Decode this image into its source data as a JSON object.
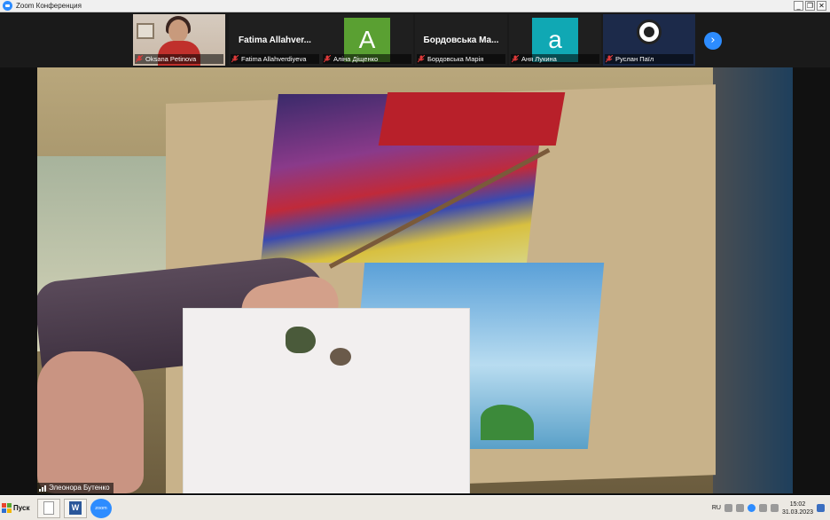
{
  "window": {
    "title": "Zoom Конференция",
    "minimize": "_",
    "restore": "❐",
    "close": "✕"
  },
  "participants": [
    {
      "name": "Oksana Petinova",
      "type": "video",
      "big_name": ""
    },
    {
      "name": "Fatima Allahverdiyeva",
      "type": "name",
      "big_name": "Fatima Allahver..."
    },
    {
      "name": "Аліна Діщенко",
      "type": "avatar",
      "initial": "A",
      "color": "#5aa032"
    },
    {
      "name": "Бордовська Марія",
      "type": "name",
      "big_name": "Бордовська Ма..."
    },
    {
      "name": "Аня Лукина",
      "type": "avatar",
      "initial": "a",
      "color": "#10a8b4"
    },
    {
      "name": "Руслан Паїл",
      "type": "obs"
    }
  ],
  "next_page_glyph": "›",
  "active_speaker": {
    "name": "Элеонора Бутенко"
  },
  "taskbar": {
    "start_label": "Пуск",
    "word_letter": "W",
    "zoom_label": "zoom",
    "language": "RU",
    "time": "15:02",
    "date": "31.03.2023"
  }
}
